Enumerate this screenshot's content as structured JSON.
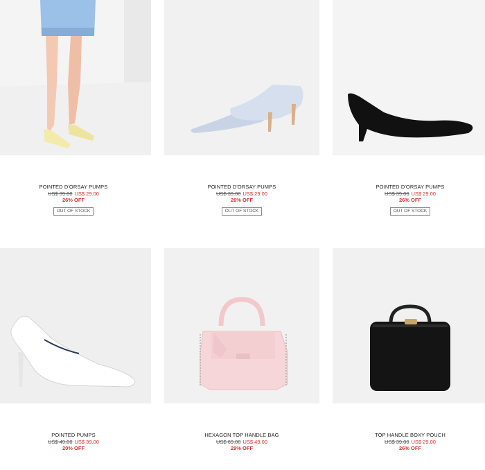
{
  "products": [
    {
      "name": "POINTED D'ORSAY PUMPS",
      "old_price": "US$ 39.00",
      "new_price": "US$ 29.00",
      "discount": "26% OFF",
      "stock_label": "OUT OF STOCK",
      "image_icon": "yellow-pumps-on-model"
    },
    {
      "name": "POINTED D'ORSAY PUMPS",
      "old_price": "US$ 39.00",
      "new_price": "US$ 29.00",
      "discount": "26% OFF",
      "stock_label": "OUT OF STOCK",
      "image_icon": "light-blue-pumps"
    },
    {
      "name": "POINTED D'ORSAY PUMPS",
      "old_price": "US$ 39.00",
      "new_price": "US$ 29.00",
      "discount": "26% OFF",
      "stock_label": "OUT OF STOCK",
      "image_icon": "black-pump"
    },
    {
      "name": "POINTED PUMPS",
      "old_price": "US$ 49.00",
      "new_price": "US$ 39.00",
      "discount": "20% OFF",
      "image_icon": "white-heel-pump"
    },
    {
      "name": "HEXAGON TOP HANDLE BAG",
      "old_price": "US$ 69.00",
      "new_price": "US$ 49.00",
      "discount": "29% OFF",
      "image_icon": "pink-handbag"
    },
    {
      "name": "TOP HANDLE BOXY POUCH",
      "old_price": "US$ 39.00",
      "new_price": "US$ 29.00",
      "discount": "26% OFF",
      "image_icon": "black-boxy-pouch"
    }
  ],
  "colors": {
    "sale_red": "#d32f2f",
    "image_bg": "#efefef",
    "text": "#222222"
  }
}
